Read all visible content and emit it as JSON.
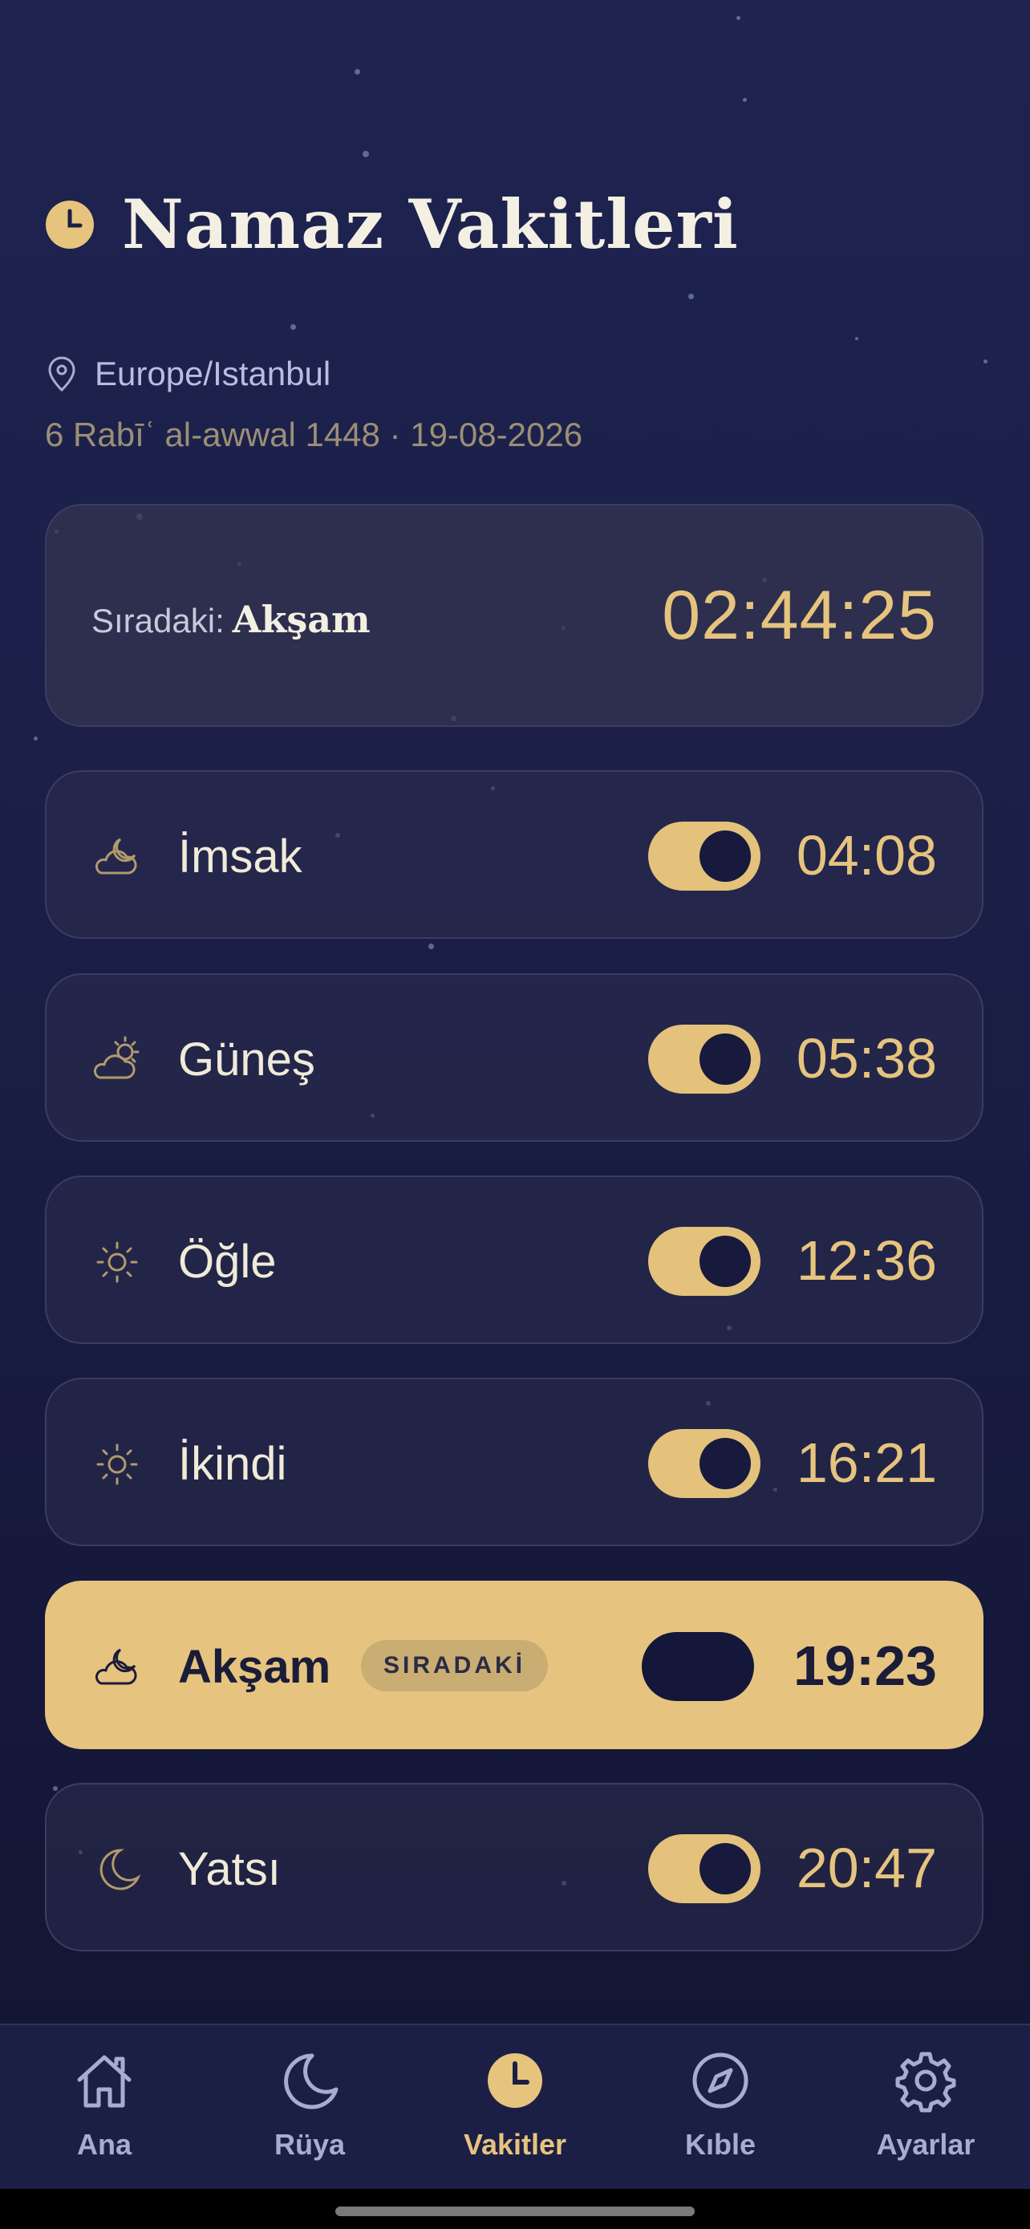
{
  "header": {
    "title": "Namaz Vakitleri"
  },
  "location": {
    "label": "Europe/Istanbul"
  },
  "dates": {
    "text": "6 Rabīʿ al-awwal 1448 · 19-08-2026"
  },
  "next_prayer": {
    "label": "Sıradaki:",
    "name": "Akşam",
    "countdown": "02:44:25"
  },
  "prayers": [
    {
      "name": "İmsak",
      "time": "04:08",
      "icon": "cloud-moon-icon",
      "enabled": true
    },
    {
      "name": "Güneş",
      "time": "05:38",
      "icon": "cloud-sun-icon",
      "enabled": true
    },
    {
      "name": "Öğle",
      "time": "12:36",
      "icon": "sun-icon",
      "enabled": true
    },
    {
      "name": "İkindi",
      "time": "16:21",
      "icon": "sun-icon",
      "enabled": true
    },
    {
      "name": "Akşam",
      "time": "19:23",
      "icon": "cloud-moon-icon",
      "enabled": false,
      "badge": "SIRADAKİ",
      "active": true
    },
    {
      "name": "Yatsı",
      "time": "20:47",
      "icon": "moon-icon",
      "enabled": true
    }
  ],
  "tabs": [
    {
      "label": "Ana",
      "icon": "home-icon"
    },
    {
      "label": "Rüya",
      "icon": "moon-icon"
    },
    {
      "label": "Vakitler",
      "icon": "clock-icon",
      "active": true
    },
    {
      "label": "Kıble",
      "icon": "compass-icon"
    },
    {
      "label": "Ayarlar",
      "icon": "gear-icon"
    }
  ],
  "colors": {
    "accent": "#e6c47e",
    "background": "#1b1f47",
    "card": "#2c2e4e",
    "active_card": "#e6c47f"
  }
}
